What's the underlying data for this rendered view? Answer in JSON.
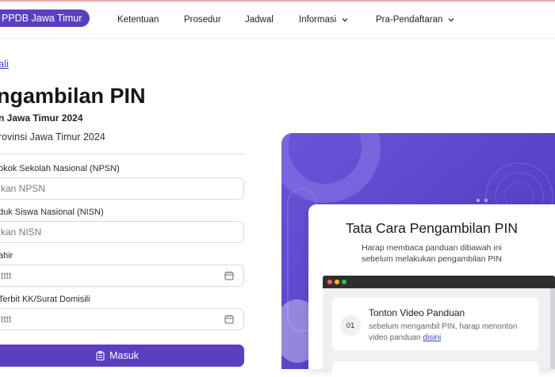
{
  "header": {
    "logo_text": "PPDB Jawa Timur",
    "nav": [
      {
        "label": "Ketentuan",
        "has_dropdown": false
      },
      {
        "label": "Prosedur",
        "has_dropdown": false
      },
      {
        "label": "Jadwal",
        "has_dropdown": false
      },
      {
        "label": "Informasi",
        "has_dropdown": true
      },
      {
        "label": "Pra-Pendaftaran",
        "has_dropdown": true
      }
    ]
  },
  "form": {
    "back_link": "ali",
    "title": "ngambilan PIN",
    "subtitle": "n Jawa Timur 2024",
    "subtitle2": "rovinsi Jawa Timur 2024",
    "fields": [
      {
        "label": "okok Sekolah Nasional (NPSN)",
        "placeholder": "kan NPSN"
      },
      {
        "label": "duk Siswa Nasional (NISN)",
        "placeholder": "kan NISN"
      },
      {
        "label": "ahir",
        "placeholder": "tttt"
      },
      {
        "label": "Terbit KK/Surat Domisili",
        "placeholder": "tttt"
      }
    ],
    "submit_label": "Masuk"
  },
  "promo": {
    "card_title": "Tata Cara Pengambilan PIN",
    "card_desc_line1": "Harap membaca panduan dibawah ini",
    "card_desc_line2": "sebelum melakukan pengambilan PIN",
    "step": {
      "number": "01",
      "title": "Tonton Video Panduan",
      "desc": "sebelum mengambil PIN, harap menonton video panduan",
      "link": "disini"
    }
  },
  "colors": {
    "brand": "#5a3fc0",
    "promo_bg": "#5641c9",
    "link": "#3f47c8",
    "dot_red": "#ff5f57",
    "dot_yellow": "#febc2e",
    "dot_green": "#28c840"
  }
}
